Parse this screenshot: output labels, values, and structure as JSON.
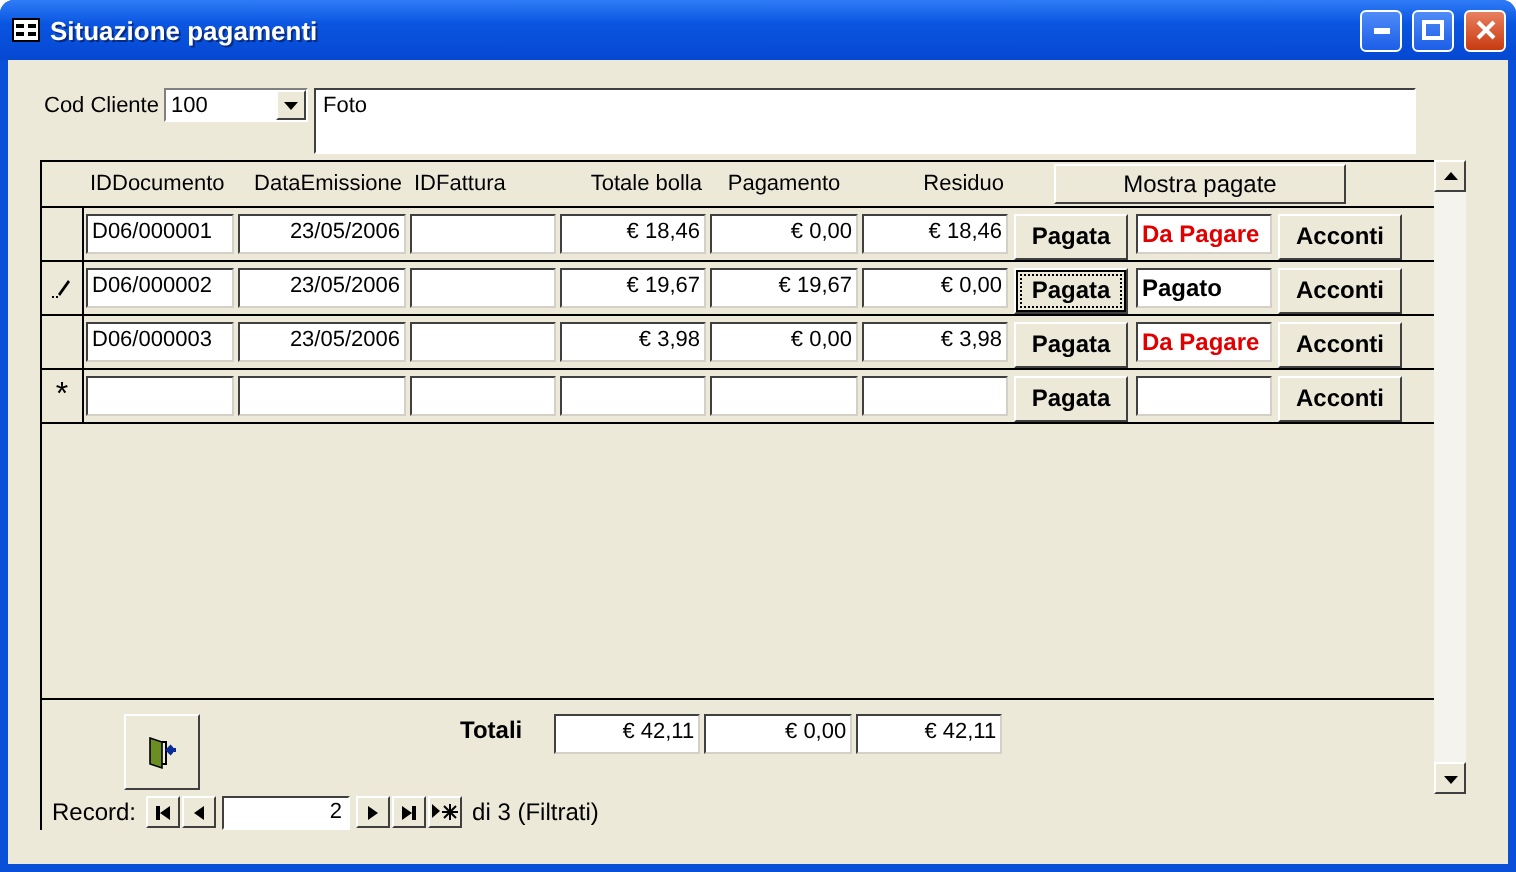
{
  "window": {
    "title": "Situazione pagamenti"
  },
  "customer": {
    "label": "Cod Cliente",
    "value": "100",
    "description": "Foto"
  },
  "columns": [
    "IDDocumento",
    "DataEmissione",
    "IDFattura",
    "Totale bolla",
    "Pagamento",
    "Residuo"
  ],
  "show_paid_button": "Mostra pagate",
  "rows": [
    {
      "kind": "record",
      "id": "D06/000001",
      "date": "23/05/2006",
      "total": "€ 18,46",
      "paid": "€ 0,00",
      "residual": "€ 18,46",
      "pay_button": {
        "label": "Pagata",
        "selected": false
      },
      "status": {
        "text": "Da Pagare",
        "kind": "unpaid"
      },
      "advances": "Acconti"
    },
    {
      "kind": "editing",
      "id": "D06/000002",
      "date": "23/05/2006",
      "total": "€ 19,67",
      "paid": "€ 19,67",
      "residual": "€ 0,00",
      "pay_button": {
        "label": "Pagata",
        "selected": true
      },
      "status": {
        "text": "Pagato",
        "kind": "paid"
      },
      "advances": "Acconti"
    },
    {
      "kind": "record",
      "id": "D06/000003",
      "date": "23/05/2006",
      "total": "€ 3,98",
      "paid": "€ 0,00",
      "residual": "€ 3,98",
      "pay_button": {
        "label": "Pagata",
        "selected": false
      },
      "status": {
        "text": "Da Pagare",
        "kind": "unpaid"
      },
      "advances": "Acconti"
    },
    {
      "kind": "new",
      "selector_mark": "*",
      "pay_button": {
        "label": "Pagata",
        "selected": false
      },
      "status": {
        "kind": "empty"
      },
      "advances": "Acconti"
    }
  ],
  "totals": {
    "label": "Totali",
    "values": [
      "€ 42,11",
      "€ 0,00",
      "€ 42,11"
    ]
  },
  "navigation": {
    "label": "Record:",
    "current": "2",
    "count": "di 3 (Filtrati)"
  }
}
